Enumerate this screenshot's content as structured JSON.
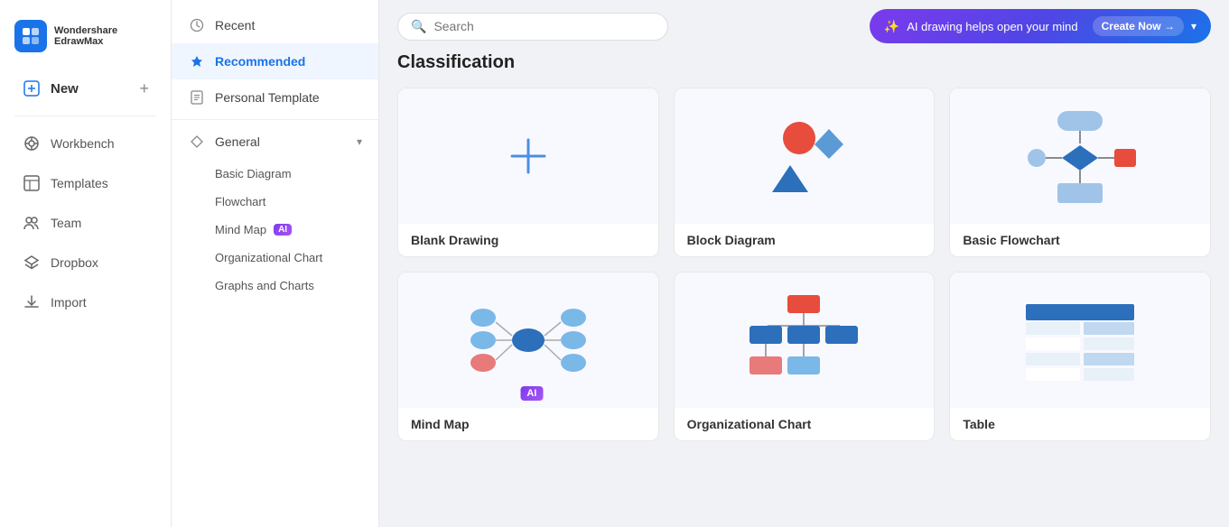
{
  "app": {
    "name": "Wondershare",
    "subtitle": "EdrawMax",
    "logo_char": "W"
  },
  "sidebar": {
    "items": [
      {
        "id": "new",
        "label": "New",
        "icon": "plus-square",
        "has_plus": true
      },
      {
        "id": "workbench",
        "label": "Workbench",
        "icon": "grid"
      },
      {
        "id": "templates",
        "label": "Templates",
        "icon": "layout"
      },
      {
        "id": "team",
        "label": "Team",
        "icon": "users"
      },
      {
        "id": "dropbox",
        "label": "Dropbox",
        "icon": "box"
      },
      {
        "id": "import",
        "label": "Import",
        "icon": "download"
      }
    ]
  },
  "middle_panel": {
    "items": [
      {
        "id": "recent",
        "label": "Recent",
        "icon": "clock"
      },
      {
        "id": "recommended",
        "label": "Recommended",
        "icon": "star",
        "active": true
      },
      {
        "id": "personal-template",
        "label": "Personal Template",
        "icon": "file"
      }
    ],
    "sections": [
      {
        "id": "general",
        "label": "General",
        "icon": "diamond",
        "expanded": true,
        "sub_items": [
          {
            "id": "basic-diagram",
            "label": "Basic Diagram"
          },
          {
            "id": "flowchart",
            "label": "Flowchart"
          },
          {
            "id": "mind-map",
            "label": "Mind Map",
            "has_ai": true
          },
          {
            "id": "org-chart",
            "label": "Organizational Chart"
          },
          {
            "id": "graphs-charts",
            "label": "Graphs and Charts"
          }
        ]
      }
    ]
  },
  "search": {
    "placeholder": "Search"
  },
  "ai_banner": {
    "text": "AI drawing helps open your mind",
    "button_label": "Create Now →",
    "icon": "✨"
  },
  "main": {
    "section_title": "Classification",
    "cards": [
      {
        "id": "blank-drawing",
        "label": "Blank Drawing",
        "type": "blank"
      },
      {
        "id": "block-diagram",
        "label": "Block Diagram",
        "type": "block"
      },
      {
        "id": "basic-flowchart",
        "label": "Basic Flowchart",
        "type": "flowchart"
      },
      {
        "id": "mind-map-card",
        "label": "Mind Map",
        "type": "mindmap",
        "has_ai": true
      },
      {
        "id": "org-chart-card",
        "label": "Organizational Chart",
        "type": "orgchart"
      },
      {
        "id": "table-card",
        "label": "Table",
        "type": "table"
      }
    ]
  }
}
